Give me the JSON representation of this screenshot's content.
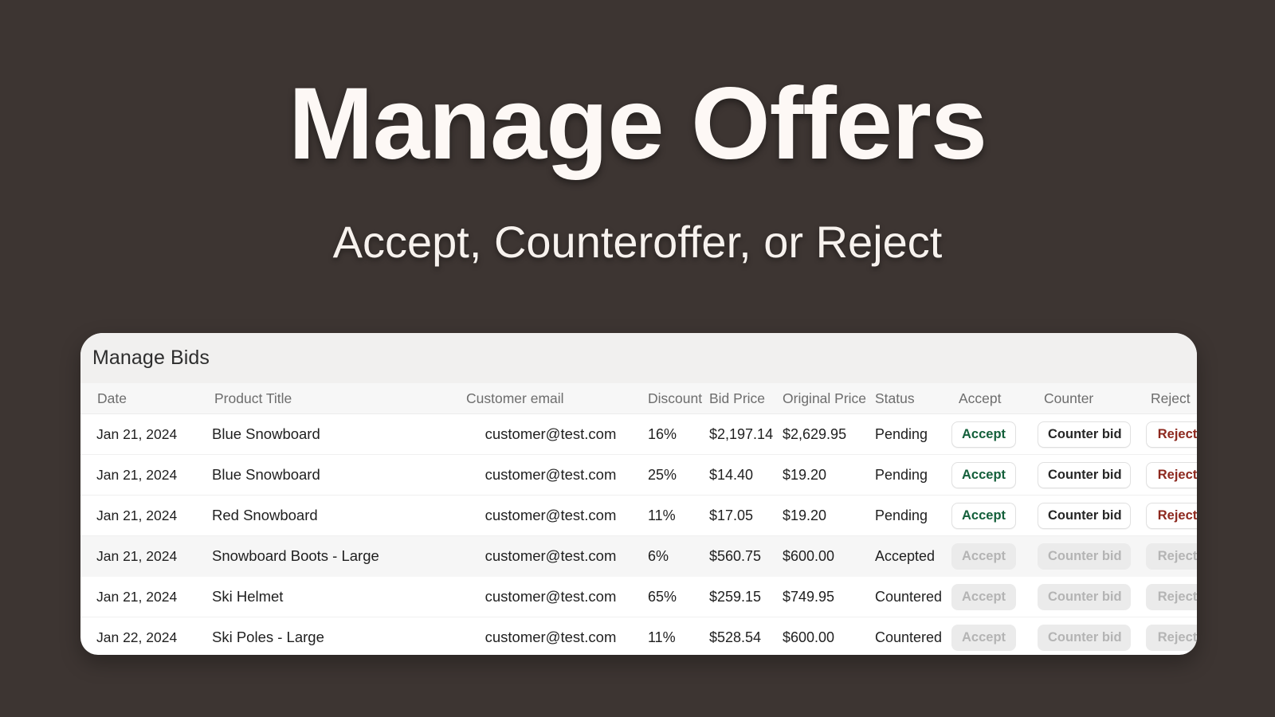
{
  "hero": {
    "title": "Manage Offers",
    "subtitle": "Accept, Counteroffer, or Reject"
  },
  "card": {
    "title": "Manage Bids"
  },
  "table": {
    "columns": [
      "Date",
      "Product Title",
      "Customer email",
      "Discount",
      "Bid Price",
      "Original Price",
      "Status",
      "Accept",
      "Counter",
      "Reject"
    ],
    "actions": {
      "accept": "Accept",
      "counter": "Counter bid",
      "reject": "Reject"
    },
    "rows": [
      {
        "date": "Jan 21, 2024",
        "product": "Blue Snowboard",
        "email": "customer@test.com",
        "discount": "16%",
        "bid_price": "$2,197.14",
        "original_price": "$2,629.95",
        "status": "Pending",
        "enabled": true,
        "striped": false
      },
      {
        "date": "Jan 21, 2024",
        "product": "Blue Snowboard",
        "email": "customer@test.com",
        "discount": "25%",
        "bid_price": "$14.40",
        "original_price": "$19.20",
        "status": "Pending",
        "enabled": true,
        "striped": false
      },
      {
        "date": "Jan 21, 2024",
        "product": "Red Snowboard",
        "email": "customer@test.com",
        "discount": "11%",
        "bid_price": "$17.05",
        "original_price": "$19.20",
        "status": "Pending",
        "enabled": true,
        "striped": false
      },
      {
        "date": "Jan 21, 2024",
        "product": "Snowboard Boots - Large",
        "email": "customer@test.com",
        "discount": "6%",
        "bid_price": "$560.75",
        "original_price": "$600.00",
        "status": "Accepted",
        "enabled": false,
        "striped": true
      },
      {
        "date": "Jan 21, 2024",
        "product": "Ski Helmet",
        "email": "customer@test.com",
        "discount": "65%",
        "bid_price": "$259.15",
        "original_price": "$749.95",
        "status": "Countered",
        "enabled": false,
        "striped": false
      },
      {
        "date": "Jan 22, 2024",
        "product": "Ski Poles - Large",
        "email": "customer@test.com",
        "discount": "11%",
        "bid_price": "$528.54",
        "original_price": "$600.00",
        "status": "Countered",
        "enabled": false,
        "striped": false
      }
    ]
  },
  "colors": {
    "background": "#3d3532",
    "card": "#ffffff",
    "card_header": "#f1f0ef",
    "table_header": "#f7f7f7",
    "stripe": "#f6f6f6",
    "accept_text": "#14603b",
    "reject_text": "#8d281e",
    "disabled_text": "#b4b4b4"
  }
}
